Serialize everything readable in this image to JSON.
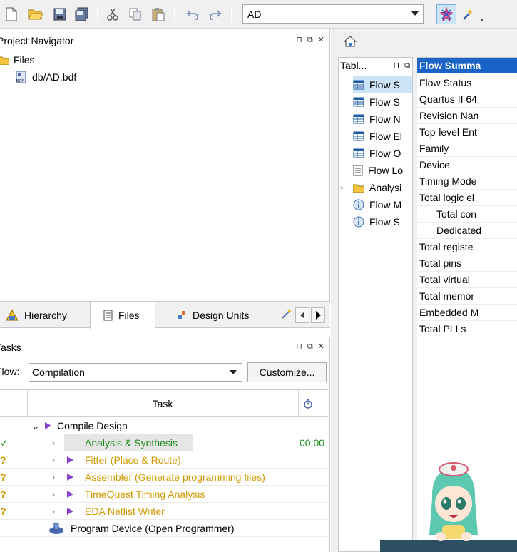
{
  "toolbar": {
    "entity_value": "AD",
    "icons": [
      "new-file-icon",
      "open-folder-icon",
      "save-icon",
      "save-all-icon",
      "cut-icon",
      "copy-icon",
      "paste-icon",
      "undo-icon",
      "redo-icon",
      "compile-icon",
      "assistant-icon"
    ]
  },
  "project_navigator": {
    "title": "Project Navigator",
    "controls": "⊓ ⧉ ✕",
    "tree": [
      {
        "label": "Files",
        "icon": "folder-icon"
      },
      {
        "label": "db/AD.bdf",
        "icon": "bdf-file-icon"
      }
    ],
    "tabs": [
      "Hierarchy",
      "Files",
      "Design Units"
    ]
  },
  "tasks": {
    "title": "Tasks",
    "flow_label": "Flow:",
    "flow_value": "Compilation",
    "customize_label": "Customize...",
    "header_task": "Task",
    "header_time_icon": "clock-icon",
    "rows": [
      {
        "status": "",
        "label": "Compile Design",
        "time": "",
        "color": "#000000",
        "level": 0,
        "chevron": "⌄"
      },
      {
        "status": "✓",
        "label": "Analysis & Synthesis",
        "time": "00:00",
        "color": "#1a8c1a",
        "level": 1,
        "chevron": "›"
      },
      {
        "status": "?",
        "label": "Fitter (Place & Route)",
        "time": "",
        "color": "#d19a00",
        "level": 1,
        "chevron": "›"
      },
      {
        "status": "?",
        "label": "Assembler (Generate programming files)",
        "time": "",
        "color": "#d19a00",
        "level": 1,
        "chevron": "›"
      },
      {
        "status": "?",
        "label": "TimeQuest Timing Analysis",
        "time": "",
        "color": "#d19a00",
        "level": 1,
        "chevron": "›"
      },
      {
        "status": "?",
        "label": "EDA Netlist Writer",
        "time": "",
        "color": "#d19a00",
        "level": 1,
        "chevron": "›"
      },
      {
        "status": "",
        "label": "Program Device (Open Programmer)",
        "time": "",
        "color": "#000000",
        "level": 2,
        "chevron": ""
      }
    ]
  },
  "report": {
    "table_header": "Tabl...",
    "tree": [
      {
        "label": "Flow S",
        "icon": "table-icon",
        "selected": true
      },
      {
        "label": "Flow S",
        "icon": "table-icon"
      },
      {
        "label": "Flow N",
        "icon": "table-icon"
      },
      {
        "label": "Flow El",
        "icon": "table-icon"
      },
      {
        "label": "Flow O",
        "icon": "table-icon"
      },
      {
        "label": "Flow Lo",
        "icon": "log-icon"
      },
      {
        "label": "Analysi",
        "icon": "folder-icon"
      },
      {
        "label": "Flow M",
        "icon": "info-icon"
      },
      {
        "label": "Flow S",
        "icon": "info-icon"
      }
    ],
    "summary_title": "Flow Summa",
    "summary_items": [
      {
        "label": "Flow Status",
        "indent": false
      },
      {
        "label": "Quartus II 64",
        "indent": false
      },
      {
        "label": "Revision Nan",
        "indent": false
      },
      {
        "label": "Top-level Ent",
        "indent": false
      },
      {
        "label": "Family",
        "indent": false
      },
      {
        "label": "Device",
        "indent": false
      },
      {
        "label": "Timing Mode",
        "indent": false
      },
      {
        "label": "Total logic el",
        "indent": false
      },
      {
        "label": "Total con",
        "indent": true
      },
      {
        "label": "Dedicated",
        "indent": true
      },
      {
        "label": "Total registe",
        "indent": false
      },
      {
        "label": "Total pins",
        "indent": false
      },
      {
        "label": "Total virtual",
        "indent": false
      },
      {
        "label": "Total memor",
        "indent": false
      },
      {
        "label": "Embedded M",
        "indent": false
      },
      {
        "label": "Total PLLs",
        "indent": false
      }
    ]
  },
  "colors": {
    "selection_blue": "#1a64c8",
    "success_green": "#1a8c1a",
    "pending_orange": "#d19a00",
    "run_purple": "#8a40cc"
  }
}
